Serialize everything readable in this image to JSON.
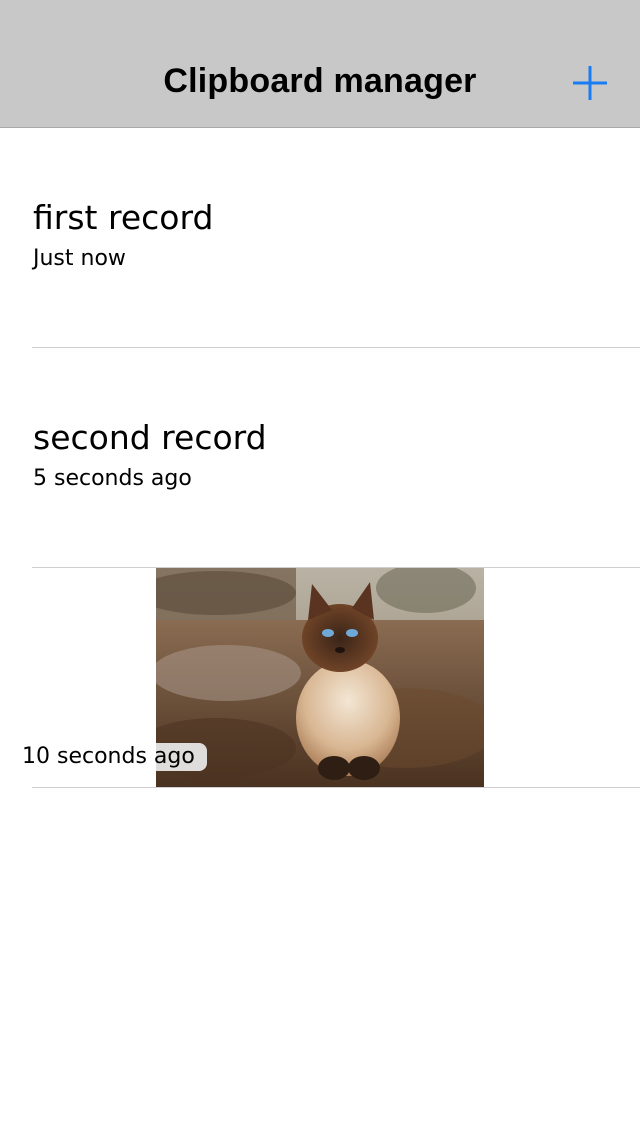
{
  "navbar": {
    "title": "Clipboard manager",
    "add_icon": "plus-icon",
    "accent_color": "#1a7cf5",
    "background_color": "#c8c8c8"
  },
  "records": [
    {
      "type": "text",
      "title": "first record",
      "time": "Just now"
    },
    {
      "type": "text",
      "title": "second record",
      "time": "5 seconds ago"
    },
    {
      "type": "image",
      "image": "cat-photo",
      "time": "10 seconds ago"
    }
  ]
}
